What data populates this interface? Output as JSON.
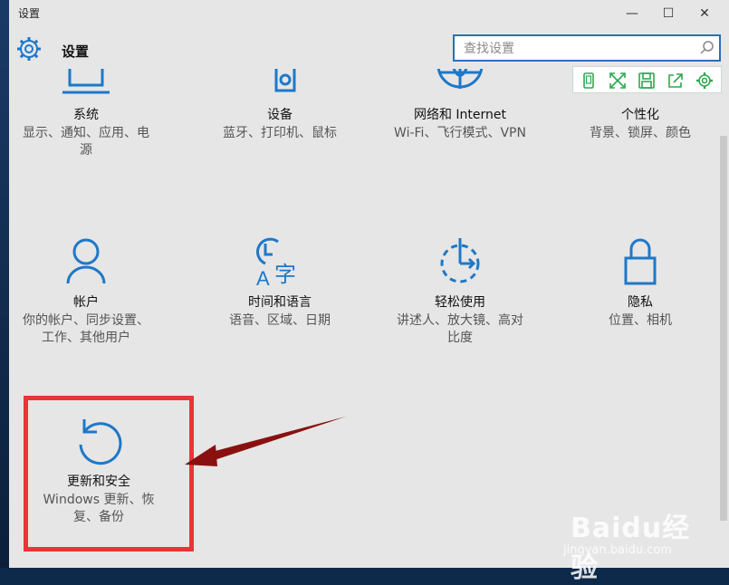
{
  "window": {
    "title": "设置"
  },
  "header": {
    "title": "设置"
  },
  "search": {
    "placeholder": "查找设置"
  },
  "tiles": [
    {
      "name": "系统",
      "desc": [
        "显示、通知、应用、电",
        "源"
      ]
    },
    {
      "name": "设备",
      "desc": [
        "蓝牙、打印机、鼠标"
      ]
    },
    {
      "name": "网络和 Internet",
      "desc": [
        "Wi-Fi、飞行模式、VPN"
      ]
    },
    {
      "name": "个性化",
      "desc": [
        "背景、锁屏、颜色"
      ]
    },
    {
      "name": "帐户",
      "desc": [
        "你的帐户、同步设置、",
        "工作、其他用户"
      ]
    },
    {
      "name": "时间和语言",
      "desc": [
        "语音、区域、日期"
      ]
    },
    {
      "name": "轻松使用",
      "desc": [
        "讲述人、放大镜、高对",
        "比度"
      ]
    },
    {
      "name": "隐私",
      "desc": [
        "位置、相机"
      ]
    },
    {
      "name": "更新和安全",
      "desc": [
        "Windows 更新、恢",
        "复、备份"
      ]
    }
  ],
  "watermark": {
    "brand": "Baidu经验",
    "url": "jingyan.baidu.com"
  },
  "colors": {
    "accent": "#1e78c8",
    "highlight": "#e8353a",
    "arrow": "#8a1010",
    "toolbar_icon": "#2fa84f"
  },
  "icons": {
    "close": "✕",
    "minimize": "—",
    "maximize": "☐"
  }
}
